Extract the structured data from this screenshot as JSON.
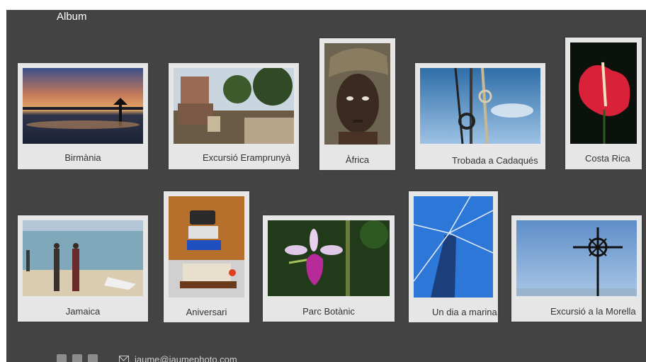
{
  "header": {
    "title": "Album"
  },
  "albums": [
    {
      "caption": "Birmània",
      "icon": "sunset-lake-photo"
    },
    {
      "caption": "Excursió Eramprunyà",
      "icon": "castle-ruins-photo"
    },
    {
      "caption": "Àfrica",
      "icon": "portrait-photo"
    },
    {
      "caption": "Trobada a Cadaqués",
      "icon": "ship-rigging-photo"
    },
    {
      "caption": "Costa Rica",
      "icon": "red-flower-photo"
    },
    {
      "caption": "Jamaica",
      "icon": "beach-photo"
    },
    {
      "caption": "Aniversari",
      "icon": "birthday-cake-photo"
    },
    {
      "caption": "Parc Botànic",
      "icon": "orchid-photo"
    },
    {
      "caption": "Un dia a marina",
      "icon": "mast-photo"
    },
    {
      "caption": "Excursió a la Morella",
      "icon": "iron-cross-photo"
    }
  ],
  "footer": {
    "social_icons": [
      "facebook-icon",
      "instagram-icon",
      "twitter-icon"
    ],
    "email": "jaume@jaumephoto.com"
  }
}
